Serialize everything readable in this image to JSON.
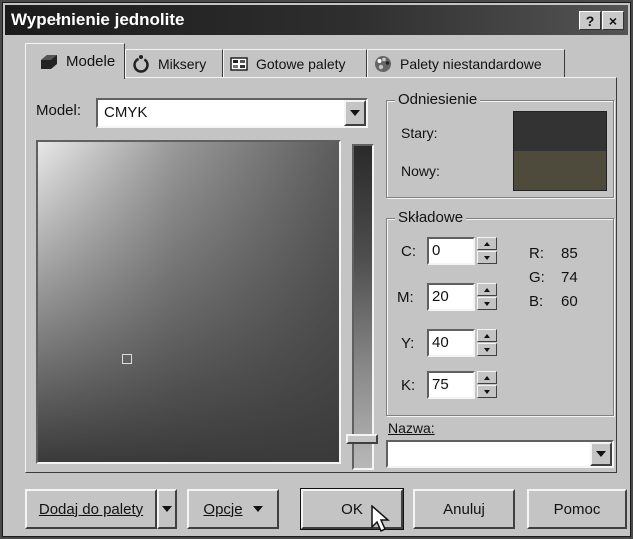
{
  "window": {
    "title": "Wypełnienie jednolite",
    "help_label": "?",
    "close_label": "×"
  },
  "tabs": [
    {
      "label": "Modele",
      "icon": "cube-icon"
    },
    {
      "label": "Miksery",
      "icon": "color-wheel-icon"
    },
    {
      "label": "Gotowe palety",
      "icon": "palette-book-icon"
    },
    {
      "label": "Palety niestandardowe",
      "icon": "palette-icon"
    }
  ],
  "model": {
    "label": "Model:",
    "value": "CMYK"
  },
  "reference": {
    "title": "Odniesienie",
    "old_label": "Stary:",
    "new_label": "Nowy:",
    "old_color": "#333333",
    "new_color": "#4e4a3c"
  },
  "components": {
    "title": "Składowe",
    "c": {
      "label": "C:",
      "value": "0"
    },
    "m": {
      "label": "M:",
      "value": "20"
    },
    "y": {
      "label": "Y:",
      "value": "40"
    },
    "k": {
      "label": "K:",
      "value": "75"
    },
    "r": {
      "label": "R:",
      "value": "85"
    },
    "g": {
      "label": "G:",
      "value": "74"
    },
    "b": {
      "label": "B:",
      "value": "60"
    }
  },
  "name": {
    "label": "Nazwa:",
    "value": ""
  },
  "buttons": {
    "add_to_palette": "Dodaj do palety",
    "options": "Opcje",
    "ok": "OK",
    "cancel": "Anuluj",
    "help": "Pomoc"
  }
}
